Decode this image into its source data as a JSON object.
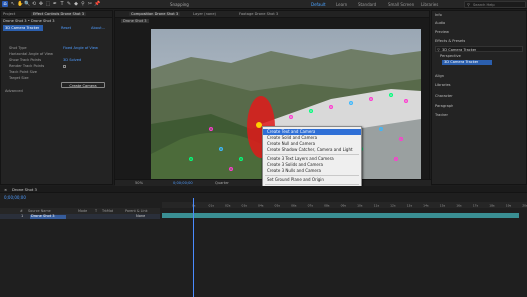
{
  "toolbar": {
    "tools": [
      "⌂",
      "↖",
      "✋",
      "🔍",
      "⟲",
      "✥",
      "⬚",
      "✒",
      "T",
      "✎",
      "◆",
      "⚲",
      "✂",
      "📌"
    ],
    "snapping_label": "Snapping",
    "workspaces": [
      "Default",
      "Learn",
      "Standard",
      "Small Screen",
      "Libraries"
    ],
    "search_placeholder": "Search Help"
  },
  "project_panel": {
    "tabs": [
      "Project",
      "Effect Controls Drone Shot 3"
    ],
    "header": "Drone Shot 3 • Drone Shot 3",
    "effect_row": {
      "name": "3D Camera Tracker",
      "reset": "Reset",
      "about": "About..."
    },
    "rows": [
      {
        "label": "3D Camera Tracker",
        "value": ""
      },
      {
        "label": "Shot Type",
        "value": "Fixed Angle of View"
      },
      {
        "label": "Horizontal Angle of View",
        "value": ""
      },
      {
        "label": "Show Track Points",
        "value": "3D Solved"
      },
      {
        "label": "Render Track Points",
        "value": ""
      },
      {
        "label": "Track Point Size",
        "value": ""
      },
      {
        "label": "Target Size",
        "value": ""
      }
    ],
    "button": "Create Camera",
    "advanced": "Advanced"
  },
  "composition": {
    "tabs": [
      "Composition Drone Shot 3",
      "Layer (none)",
      "Footage Drone Shot 3"
    ],
    "crumb": "Drone Shot 3",
    "zoom": "50%",
    "timecode": "0;00;00;00",
    "quality": "Quarter",
    "view": "Active Camera",
    "views": "1 View"
  },
  "context_menu": {
    "items": [
      "Create Text and Camera",
      "Create Solid and Camera",
      "Create Null and Camera",
      "Create Shadow Catcher, Camera and Light",
      "Create 3 Text Layers and Camera",
      "Create 3 Solids and Camera",
      "Create 3 Nulls and Camera",
      "Set Ground Plane and Origin",
      "Delete Selected Points"
    ],
    "highlighted": 0
  },
  "right_panel": {
    "items": [
      "Info",
      "Audio",
      "Preview",
      "Effects & Presets",
      "3D Camera Tracker",
      "Perspective",
      "Align",
      "Libraries",
      "Character",
      "Paragraph",
      "Tracker"
    ],
    "search_placeholder": "3D Camera Tracker"
  },
  "timeline": {
    "tab": "Drone Shot 3",
    "timecode": "0;00;00;00",
    "headers": [
      "#",
      "Source Name",
      "Mode",
      "T",
      "TrkMat",
      "Parent & Link"
    ],
    "layer": {
      "num": "1",
      "name": "Drone Shot 3",
      "parent": "None"
    },
    "ruler_marks": [
      "0s",
      "01s",
      "02s",
      "03s",
      "04s",
      "05s",
      "06s",
      "07s",
      "08s",
      "09s",
      "10s",
      "11s",
      "12s",
      "13s",
      "14s",
      "15s",
      "16s",
      "17s",
      "18s",
      "19s",
      "20s"
    ]
  },
  "colors": {
    "accent": "#2c5db8",
    "highlight": "#2f6fd6",
    "layer": "#3a8f93",
    "target": "#e01a1a"
  }
}
